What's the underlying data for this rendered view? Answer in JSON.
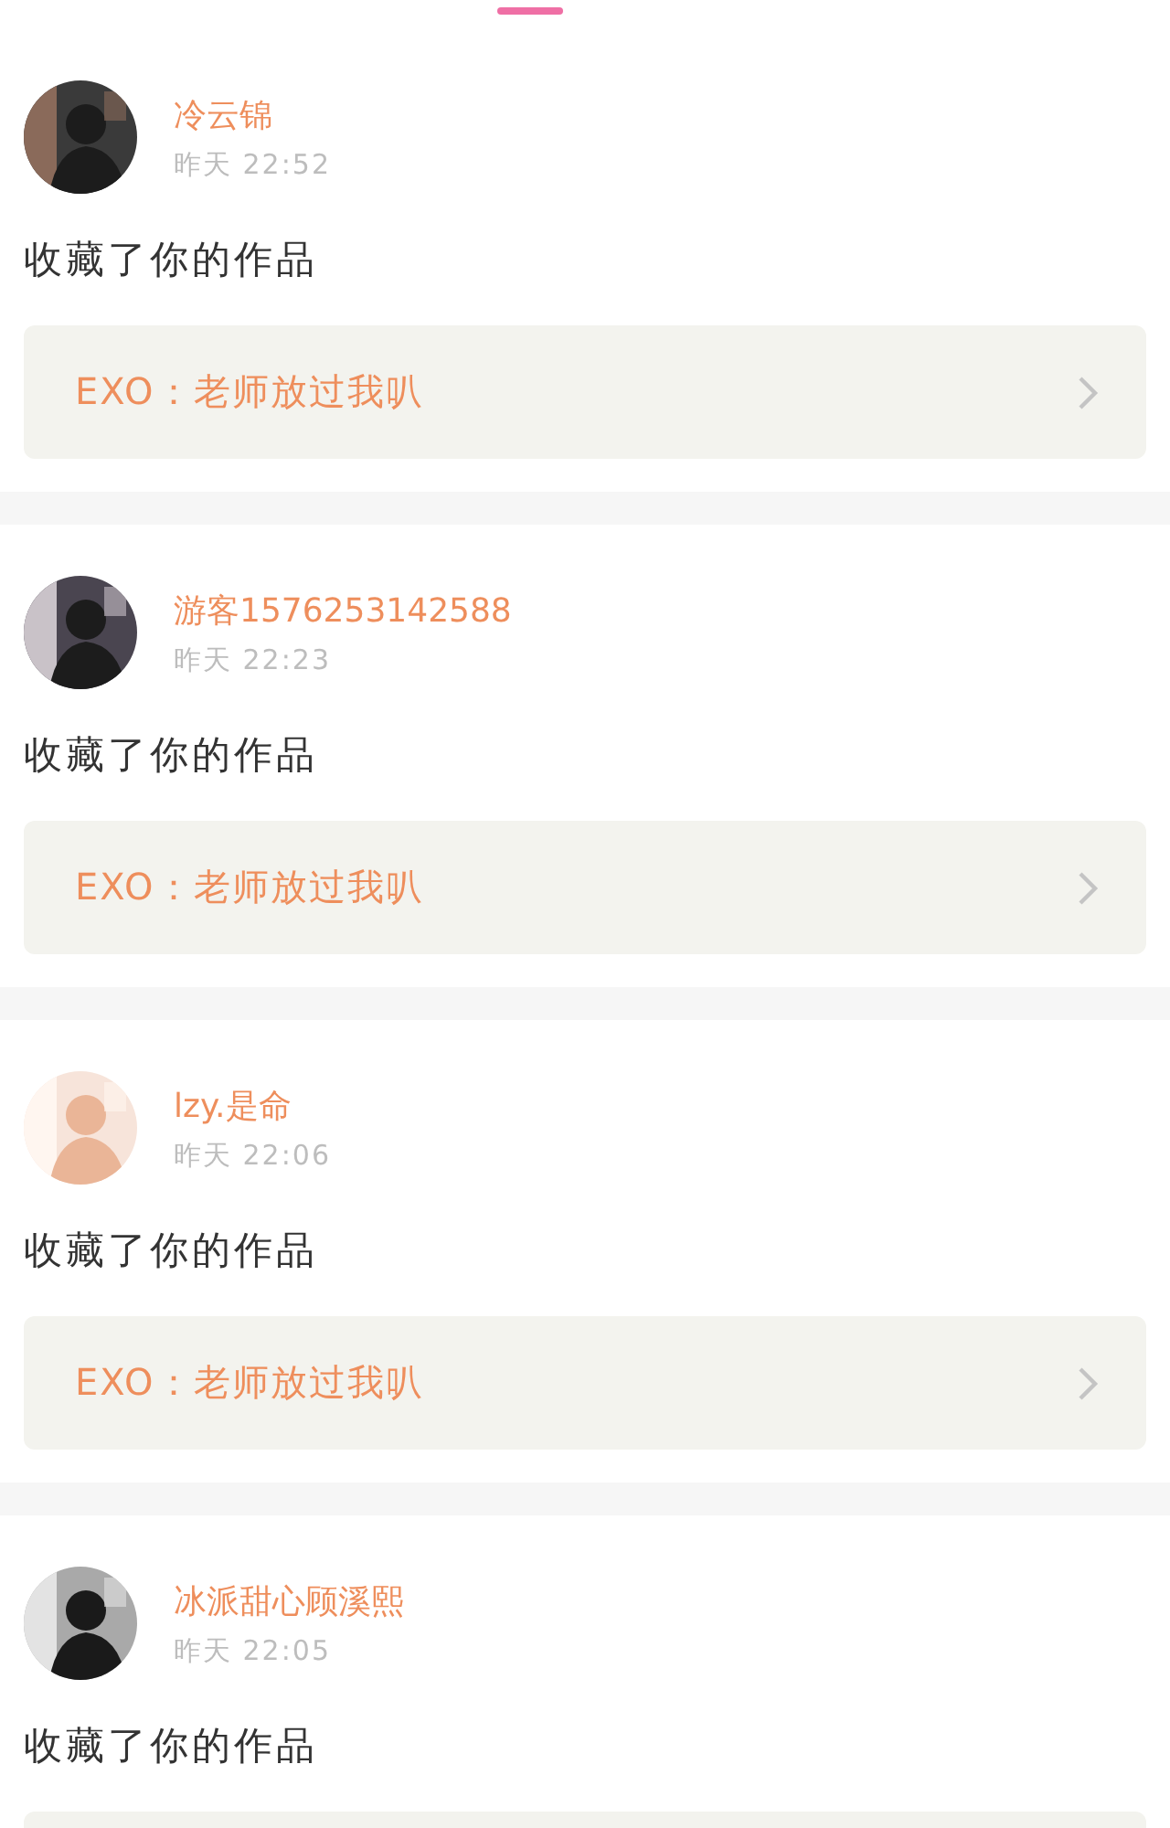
{
  "tab_indicator": {
    "selected": true
  },
  "notifications": [
    {
      "user": "冷云锦",
      "time": "昨天 22:52",
      "action": "收藏了你的作品",
      "work": "EXO：老师放过我叭"
    },
    {
      "user": "游客1576253142588",
      "time": "昨天 22:23",
      "action": "收藏了你的作品",
      "work": "EXO：老师放过我叭"
    },
    {
      "user": "lzy.是命",
      "time": "昨天 22:06",
      "action": "收藏了你的作品",
      "work": "EXO：老师放过我叭"
    },
    {
      "user": "冰派甜心顾溪熙",
      "time": "昨天 22:05",
      "action": "收藏了你的作品"
    }
  ]
}
